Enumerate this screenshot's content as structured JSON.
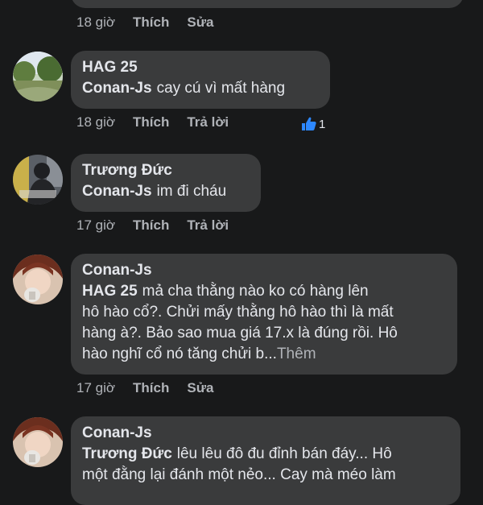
{
  "comments": [
    {
      "time": "18 giờ",
      "like_label": "Thích",
      "action_label": "Sửa"
    },
    {
      "author": "HAG 25",
      "mention": "Conan-Js",
      "text": "cay cú vì mất hàng",
      "time": "18 giờ",
      "like_label": "Thích",
      "action_label": "Trả lời",
      "reaction_count": "1",
      "reaction_icon": "thumbs-up-icon"
    },
    {
      "author": "Trương Đức",
      "mention": "Conan-Js",
      "text": "im đi cháu",
      "time": "17 giờ",
      "like_label": "Thích",
      "action_label": "Trả lời"
    },
    {
      "author": "Conan-Js",
      "mention": "HAG 25",
      "text_lines": [
        "mả cha thằng nào ko có hàng lên",
        "hô hào cổ?. Chửi mấy thằng hô hào thì là mất",
        "hàng à?. Bảo sao mua giá 17.x là đúng rồi. Hô",
        "hào nghĩ cổ nó tăng chửi b..."
      ],
      "see_more": "Thêm",
      "time": "17 giờ",
      "like_label": "Thích",
      "action_label": "Sửa"
    },
    {
      "author": "Conan-Js",
      "mention": "Trương Đức",
      "text_lines": [
        "lêu lêu đô đu đỉnh bán đáy... Hô",
        "một đằng lại đánh một nẻo... Cay mà méo làm"
      ]
    }
  ],
  "colors": {
    "background": "#18191a",
    "bubble": "#3a3b3c",
    "text": "#e4e6eb",
    "muted": "#b0b3b8",
    "like_blue": "#2d88ff"
  }
}
